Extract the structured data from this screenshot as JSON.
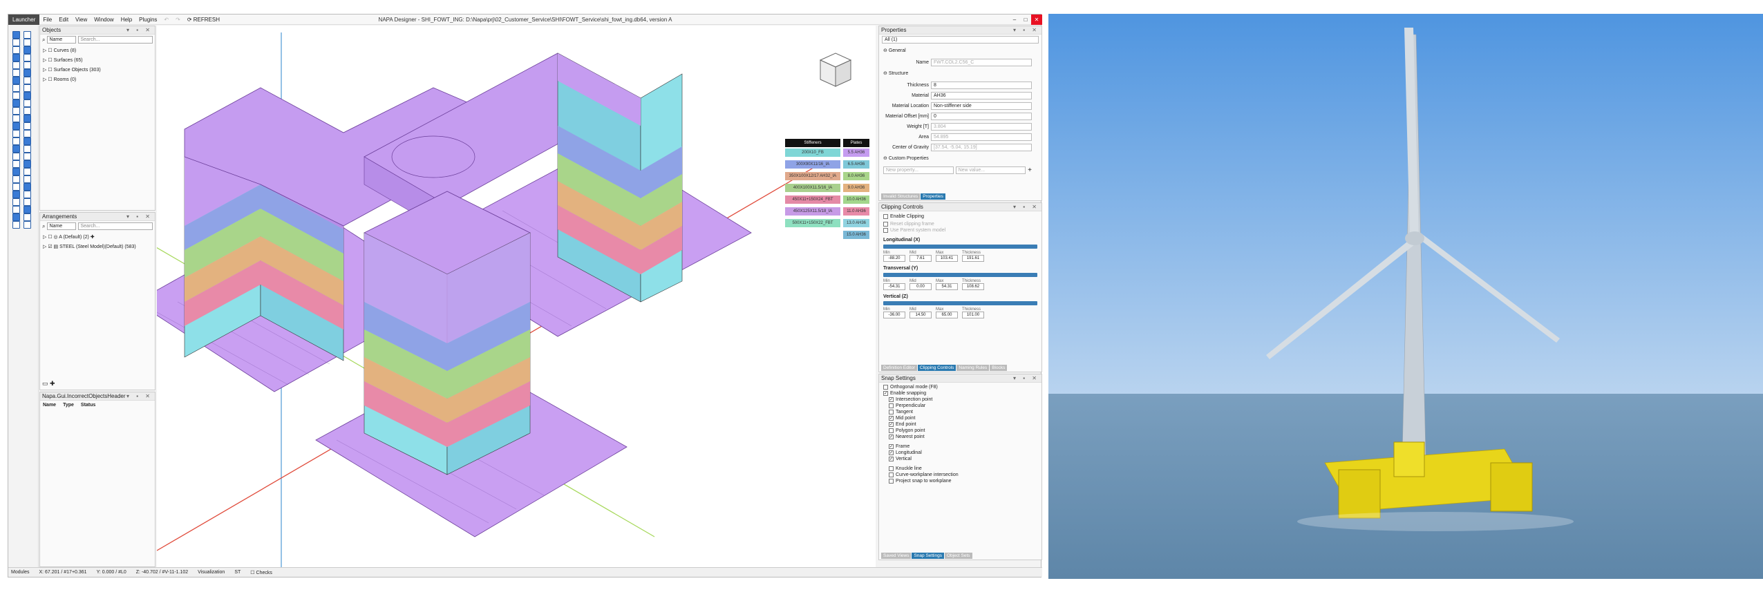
{
  "menu": {
    "launcher": "Launcher",
    "items": [
      "File",
      "Edit",
      "View",
      "Window",
      "Help",
      "Plugins"
    ],
    "refresh": "REFRESH"
  },
  "window_title": "NAPA Designer - SHI_FOWT_ING: D:\\Napa\\prj\\02_Customer_Service\\SHI\\FOWT_Service\\shi_fowt_ing.db64, version A",
  "objects": {
    "title": "Objects",
    "combo": "Name",
    "search_placeholder": "Search...",
    "tree": [
      {
        "label": "Curves",
        "count": "(8)"
      },
      {
        "label": "Surfaces",
        "count": "(65)"
      },
      {
        "label": "Surface Objects",
        "count": "(303)"
      },
      {
        "label": "Rooms",
        "count": "(0)"
      }
    ]
  },
  "arrangements": {
    "title": "Arrangements",
    "combo": "Name",
    "search_placeholder": "Search...",
    "tree": [
      {
        "label": "A (Default)",
        "count": "(2)"
      },
      {
        "label": "STEEL (Steel Model)(Default)",
        "count": "(583)"
      }
    ]
  },
  "incorrect": {
    "title": "Napa.Gui.IncorrectObjectsHeader",
    "cols": [
      "Name",
      "Type",
      "Status"
    ]
  },
  "properties": {
    "title": "Properties",
    "filter": "All (1)",
    "general": "General",
    "name_label": "Name",
    "name_value": "FWT.COL2.C56_C",
    "structure": "Structure",
    "fields": [
      {
        "label": "Thickness",
        "value": "8",
        "disabled": false
      },
      {
        "label": "Material",
        "value": "AH36",
        "disabled": false
      },
      {
        "label": "Material Location",
        "value": "Non-stiffener side",
        "disabled": false
      },
      {
        "label": "Material Offset [mm]",
        "value": "0",
        "disabled": false
      },
      {
        "label": "Weight [T]",
        "value": "3.804",
        "disabled": true
      },
      {
        "label": "Area",
        "value": "54.895",
        "disabled": true
      },
      {
        "label": "Center of Gravity",
        "value": "[37.54, -5.04, 15.19]",
        "disabled": true
      }
    ],
    "custom": "Custom Properties",
    "new_property": "New property...",
    "new_value": "New value...",
    "tabs": [
      "Invalid Structures",
      "Properties"
    ]
  },
  "clipping": {
    "title": "Clipping Controls",
    "enable": "Enable Clipping",
    "opt2": "Reset clipping frame",
    "opt3": "Use Parent system model",
    "groups": [
      {
        "name": "Longitudinal (X)",
        "min": "-88.20",
        "mid": "7.61",
        "max": "103.41",
        "thickness": "191.61"
      },
      {
        "name": "Transversal (Y)",
        "min": "-54.31",
        "mid": "0.00",
        "max": "54.31",
        "thickness": "108.62"
      },
      {
        "name": "Vertical (Z)",
        "min": "-36.00",
        "mid": "14.50",
        "max": "65.00",
        "thickness": "101.00"
      }
    ],
    "col_labels": [
      "Min",
      "Mid",
      "Max",
      "Thickness"
    ],
    "tabs": [
      "Definition Editor",
      "Clipping Controls",
      "Naming Rules",
      "Blocks"
    ]
  },
  "snap": {
    "title": "Snap Settings",
    "items": [
      {
        "label": "Orthogonal mode (F8)",
        "checked": false,
        "indent": 0
      },
      {
        "label": "Enable snapping",
        "checked": true,
        "indent": 0
      },
      {
        "label": "Intersection point",
        "checked": true,
        "indent": 1
      },
      {
        "label": "Perpendicular",
        "checked": false,
        "indent": 1
      },
      {
        "label": "Tangent",
        "checked": false,
        "indent": 1
      },
      {
        "label": "Mid point",
        "checked": true,
        "indent": 1
      },
      {
        "label": "End point",
        "checked": true,
        "indent": 1
      },
      {
        "label": "Polygon point",
        "checked": false,
        "indent": 1
      },
      {
        "label": "Nearest point",
        "checked": true,
        "indent": 1
      },
      {
        "label": "Frame",
        "checked": true,
        "indent": 1
      },
      {
        "label": "Longitudinal",
        "checked": true,
        "indent": 1
      },
      {
        "label": "Vertical",
        "checked": true,
        "indent": 1
      },
      {
        "label": "Knuckle line",
        "checked": false,
        "indent": 1
      },
      {
        "label": "Curve-workplane intersection",
        "checked": false,
        "indent": 1
      },
      {
        "label": "Project snap to workplane",
        "checked": false,
        "indent": 1
      }
    ],
    "tabs": [
      "Saved Views",
      "Snap Settings",
      "Object Sets"
    ]
  },
  "legend": {
    "stiff_header": "Stiffeners",
    "plate_header": "Plates",
    "stiffeners": [
      {
        "label": "200X10_FB",
        "color": "#7fd6d6"
      },
      {
        "label": "300X90X11/16_IA",
        "color": "#8fa3e6"
      },
      {
        "label": "350X100X12/17 AH32_IA",
        "color": "#e0a98c"
      },
      {
        "label": "400X100X11.5/16_IA",
        "color": "#a9d08e"
      },
      {
        "label": "450X11+150X24_FBT",
        "color": "#e48aa6"
      },
      {
        "label": "450X125X11.5/18_IA",
        "color": "#c79be6"
      },
      {
        "label": "500X11+150X22_FBT",
        "color": "#8ee0c0"
      }
    ],
    "plates": [
      {
        "label": "5.5 AH36",
        "color": "#c59cf0"
      },
      {
        "label": "6.5 AH36",
        "color": "#7fc8d8"
      },
      {
        "label": "8.0 AH36",
        "color": "#a9d58a"
      },
      {
        "label": "9.0 AH36",
        "color": "#e3b27f"
      },
      {
        "label": "10.0 AH36",
        "color": "#a3d68c"
      },
      {
        "label": "11.0 AH36",
        "color": "#e88aa8"
      },
      {
        "label": "13.0 AH36",
        "color": "#8fd3e0"
      },
      {
        "label": "15.0 AH36",
        "color": "#7ab8d6"
      }
    ]
  },
  "status": {
    "modules": "Modules",
    "x": "X: 67.201 / #17+0.361",
    "y": "Y: 0.000 / #L0",
    "z": "Z: -40.702 / #V-11-1.102",
    "visualization": "Visualization",
    "st": "ST",
    "checks": "Checks"
  }
}
